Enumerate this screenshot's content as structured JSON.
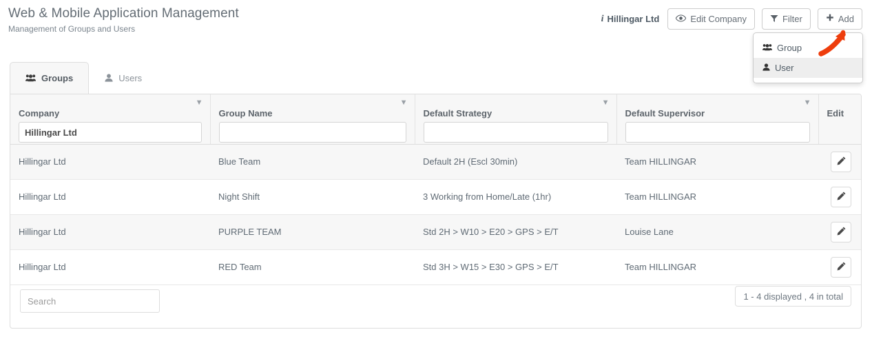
{
  "header": {
    "title": "Web & Mobile Application Management",
    "subtitle": "Management of Groups and Users",
    "company_indicator": {
      "icon": "info-italic-i-icon",
      "label": "Hillingar Ltd"
    },
    "buttons": [
      {
        "label": "Edit Company",
        "icon": "eye-icon"
      },
      {
        "label": "Filter",
        "icon": "funnel-icon"
      },
      {
        "label": "Add",
        "icon": "plus-icon"
      }
    ]
  },
  "add_dropdown": {
    "open": true,
    "items": [
      {
        "label": "Group",
        "icon": "users-group-icon",
        "active": false
      },
      {
        "label": "User",
        "icon": "single-user-icon",
        "active": true
      }
    ]
  },
  "annotation": {
    "type": "hand-drawn-arrow",
    "points_to": "Add",
    "color": "#ee3d0c"
  },
  "tabs": [
    {
      "label": "Groups",
      "icon": "users-group-icon",
      "active": true
    },
    {
      "label": "Users",
      "icon": "single-user-icon",
      "active": false
    }
  ],
  "table": {
    "columns": [
      {
        "label": "Company",
        "filter_value": "Hillingar Ltd",
        "has_caret": true,
        "has_filter": true
      },
      {
        "label": "Group Name",
        "filter_value": "",
        "has_caret": true,
        "has_filter": true
      },
      {
        "label": "Default Strategy",
        "filter_value": "",
        "has_caret": true,
        "has_filter": true
      },
      {
        "label": "Default Supervisor",
        "filter_value": "",
        "has_caret": true,
        "has_filter": true
      },
      {
        "label": "Edit",
        "filter_value": "",
        "has_caret": false,
        "has_filter": false
      }
    ],
    "rows": [
      {
        "company": "Hillingar Ltd",
        "group_name": "Blue Team",
        "default_strategy": "Default 2H (Escl 30min)",
        "default_supervisor": "Team HILLINGAR",
        "edit_icon": "pencil-icon"
      },
      {
        "company": "Hillingar Ltd",
        "group_name": "Night Shift",
        "default_strategy": "3 Working from Home/Late (1hr)",
        "default_supervisor": "Team HILLINGAR",
        "edit_icon": "pencil-icon"
      },
      {
        "company": "Hillingar Ltd",
        "group_name": "PURPLE TEAM",
        "default_strategy": "Std 2H > W10 > E20 > GPS > E/T",
        "default_supervisor": "Louise Lane",
        "edit_icon": "pencil-icon"
      },
      {
        "company": "Hillingar Ltd",
        "group_name": "RED Team",
        "default_strategy": "Std 3H > W15 > E30 > GPS > E/T",
        "default_supervisor": "Team HILLINGAR",
        "edit_icon": "pencil-icon"
      }
    ],
    "footer": {
      "search_placeholder": "Search",
      "search_value": "",
      "pagination_text": "1 - 4 displayed , 4 in total"
    }
  },
  "colors": {
    "annotation_red": "#ee3d0c",
    "panel_border": "#dddddd",
    "header_bg": "#f7f7f7",
    "row_alt_bg": "#f7f7f7",
    "text": "#5f6a74"
  }
}
